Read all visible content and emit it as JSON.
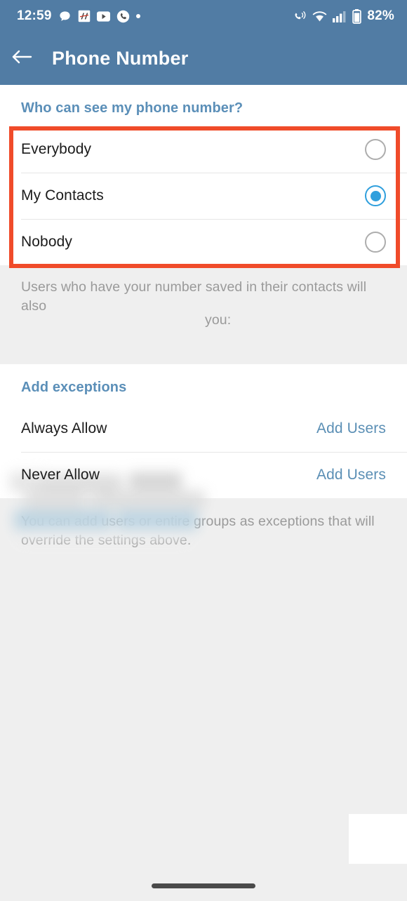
{
  "status_bar": {
    "time": "12:59",
    "battery_percent": "82%",
    "left_icons": [
      "chat-bubble-icon",
      "app-notification-icon",
      "youtube-icon",
      "phone-call-icon",
      "more-dot-icon"
    ],
    "right_icons": [
      "call-active-icon",
      "wifi-icon",
      "cellular-signal-icon",
      "battery-icon"
    ]
  },
  "app_bar": {
    "back_icon": "arrow-left-icon",
    "title": "Phone Number"
  },
  "visibility_section": {
    "header": "Who can see my phone number?",
    "options": [
      {
        "label": "Everybody",
        "selected": false
      },
      {
        "label": "My Contacts",
        "selected": true
      },
      {
        "label": "Nobody",
        "selected": false
      }
    ],
    "footnote": "Users who have your number saved in their contacts will also",
    "footnote_tail": "you:",
    "footnote_redacted": true
  },
  "exceptions_section": {
    "header": "Add exceptions",
    "rows": [
      {
        "label": "Always Allow",
        "action": "Add Users"
      },
      {
        "label": "Never Allow",
        "action": "Add Users"
      }
    ],
    "footnote": "You can add users or entire groups as exceptions that will override the settings above."
  },
  "annotation": {
    "type": "highlight-rectangle",
    "color": "#f04b2a",
    "targets": [
      "Everybody",
      "My Contacts",
      "Nobody"
    ]
  },
  "colors": {
    "app_bar": "#517ca4",
    "accent_blue": "#2f9fdd",
    "link_blue": "#5b8fb5",
    "header_blue": "#5b8fb8",
    "page_bg": "#efefef",
    "card_bg": "#ffffff",
    "annotation_red": "#f04b2a"
  },
  "nav_bar": {
    "gesture_pill": "home-gesture-pill"
  }
}
